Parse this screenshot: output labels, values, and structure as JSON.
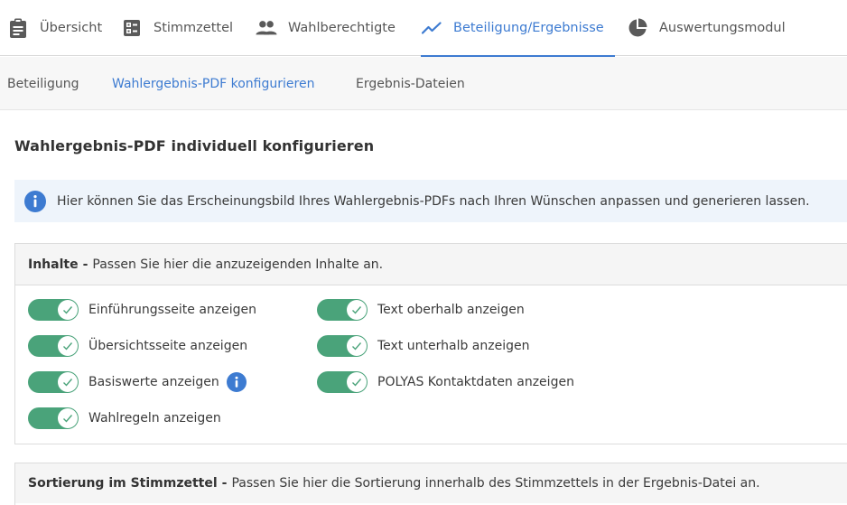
{
  "topnav": {
    "tabs": [
      {
        "label": "Übersicht"
      },
      {
        "label": "Stimmzettel"
      },
      {
        "label": "Wahlberechtigte"
      },
      {
        "label": "Beteiligung/Ergebnisse"
      },
      {
        "label": "Auswertungsmodul"
      }
    ],
    "active_index": 3
  },
  "subnav": {
    "tabs": [
      {
        "label": "Beteiligung"
      },
      {
        "label": "Wahlergebnis-PDF konfigurieren"
      },
      {
        "label": "Ergebnis-Dateien"
      }
    ],
    "active_index": 1
  },
  "page": {
    "title": "Wahlergebnis-PDF individuell konfigurieren",
    "info_text": "Hier können Sie das Erscheinungsbild Ihres Wahlergebnis-PDFs nach Ihren Wünschen anpassen und generieren lassen."
  },
  "inhalte": {
    "heading": "Inhalte",
    "separator": "-",
    "description": "Passen Sie hier die anzuzeigenden Inhalte an.",
    "left_toggles": [
      {
        "label": "Einführungsseite anzeigen",
        "checked": true
      },
      {
        "label": "Übersichtsseite anzeigen",
        "checked": true
      },
      {
        "label": "Basiswerte anzeigen",
        "checked": true
      },
      {
        "label": "Wahlregeln anzeigen",
        "checked": true
      }
    ],
    "right_toggles": [
      {
        "label": "Text oberhalb anzeigen",
        "checked": true
      },
      {
        "label": "Text unterhalb anzeigen",
        "checked": true
      },
      {
        "label": "POLYAS Kontaktdaten anzeigen",
        "checked": true
      }
    ]
  },
  "sortierung": {
    "heading": "Sortierung im Stimmzettel",
    "separator": "-",
    "description": "Passen Sie hier die Sortierung innerhalb des Stimmzettels in der Ergebnis-Datei an."
  },
  "colors": {
    "accent": "#3d7bd1",
    "toggle_on": "#4aa37a",
    "info_bg": "#eef4fb",
    "icon_gray": "#5a5a5a"
  },
  "icons": {
    "tab_icons": [
      "clipboard-icon",
      "ballot-icon",
      "people-icon",
      "trending-up-icon",
      "pie-chart-icon"
    ],
    "info": "info-icon",
    "toggle_check": "check-icon"
  }
}
